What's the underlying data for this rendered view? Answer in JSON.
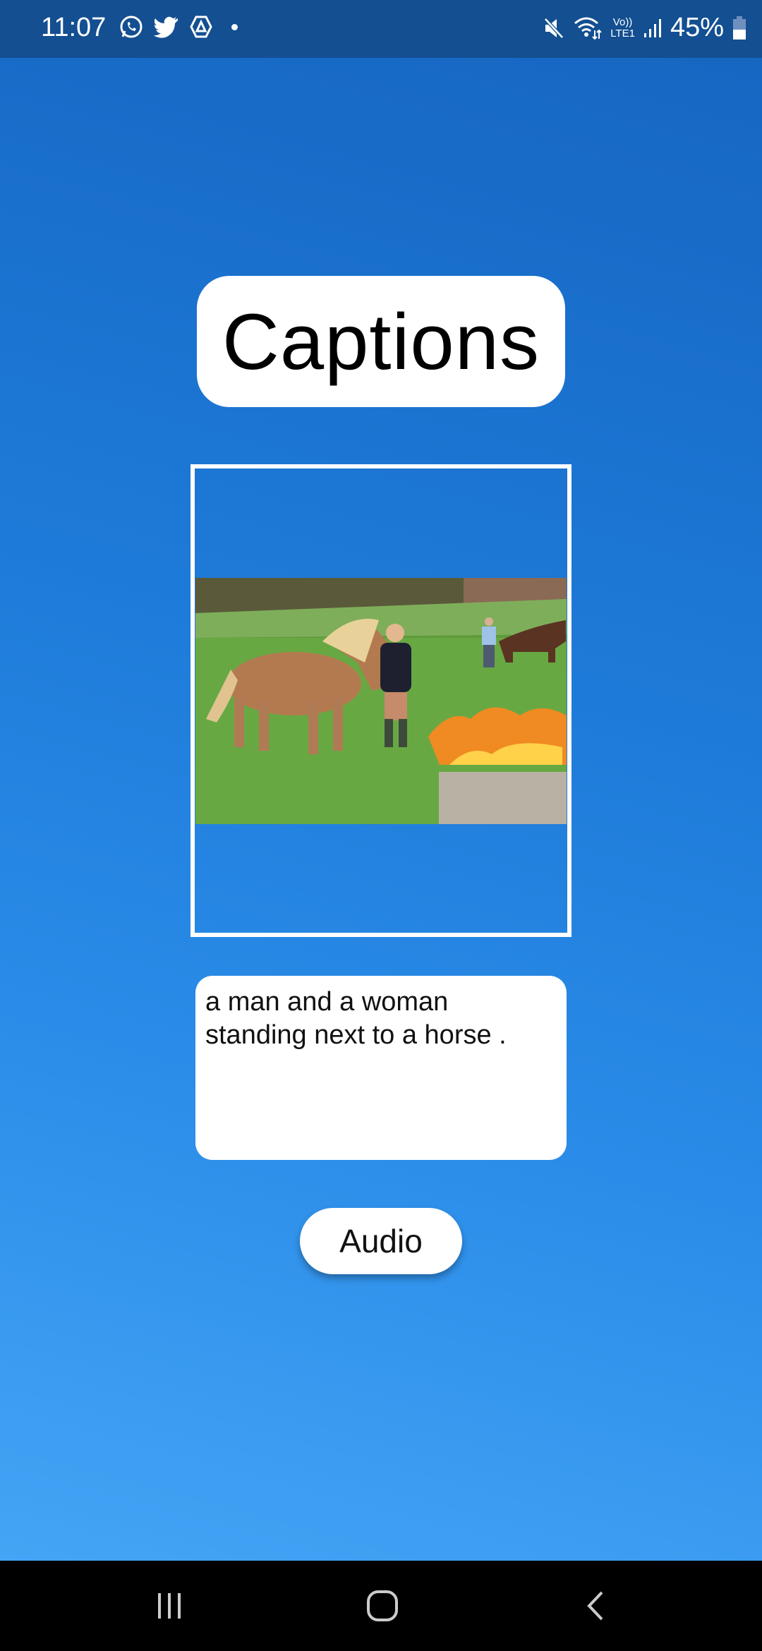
{
  "status_bar": {
    "time": "11:07",
    "left_icons": [
      "whatsapp-icon",
      "twitter-icon",
      "drive-icon",
      "dot-icon"
    ],
    "right_icons": [
      "mute-icon",
      "wifi-icon",
      "volte-lte-icon",
      "signal-icon"
    ],
    "volte": "Vo))",
    "lte": "LTE1",
    "battery": "45%",
    "battery_level": 0.45
  },
  "header": {
    "title": "Captions"
  },
  "image": {
    "description_hidden": null
  },
  "caption": {
    "text": "a man and a woman standing next to a horse ."
  },
  "audio_button": {
    "label": "Audio"
  },
  "nav": {
    "icons": [
      "recent-apps-icon",
      "home-icon",
      "back-icon"
    ]
  },
  "colors": {
    "status_bar": "#134f91",
    "bg_top": "#1565c0",
    "bg_bottom": "#48a8f7"
  }
}
